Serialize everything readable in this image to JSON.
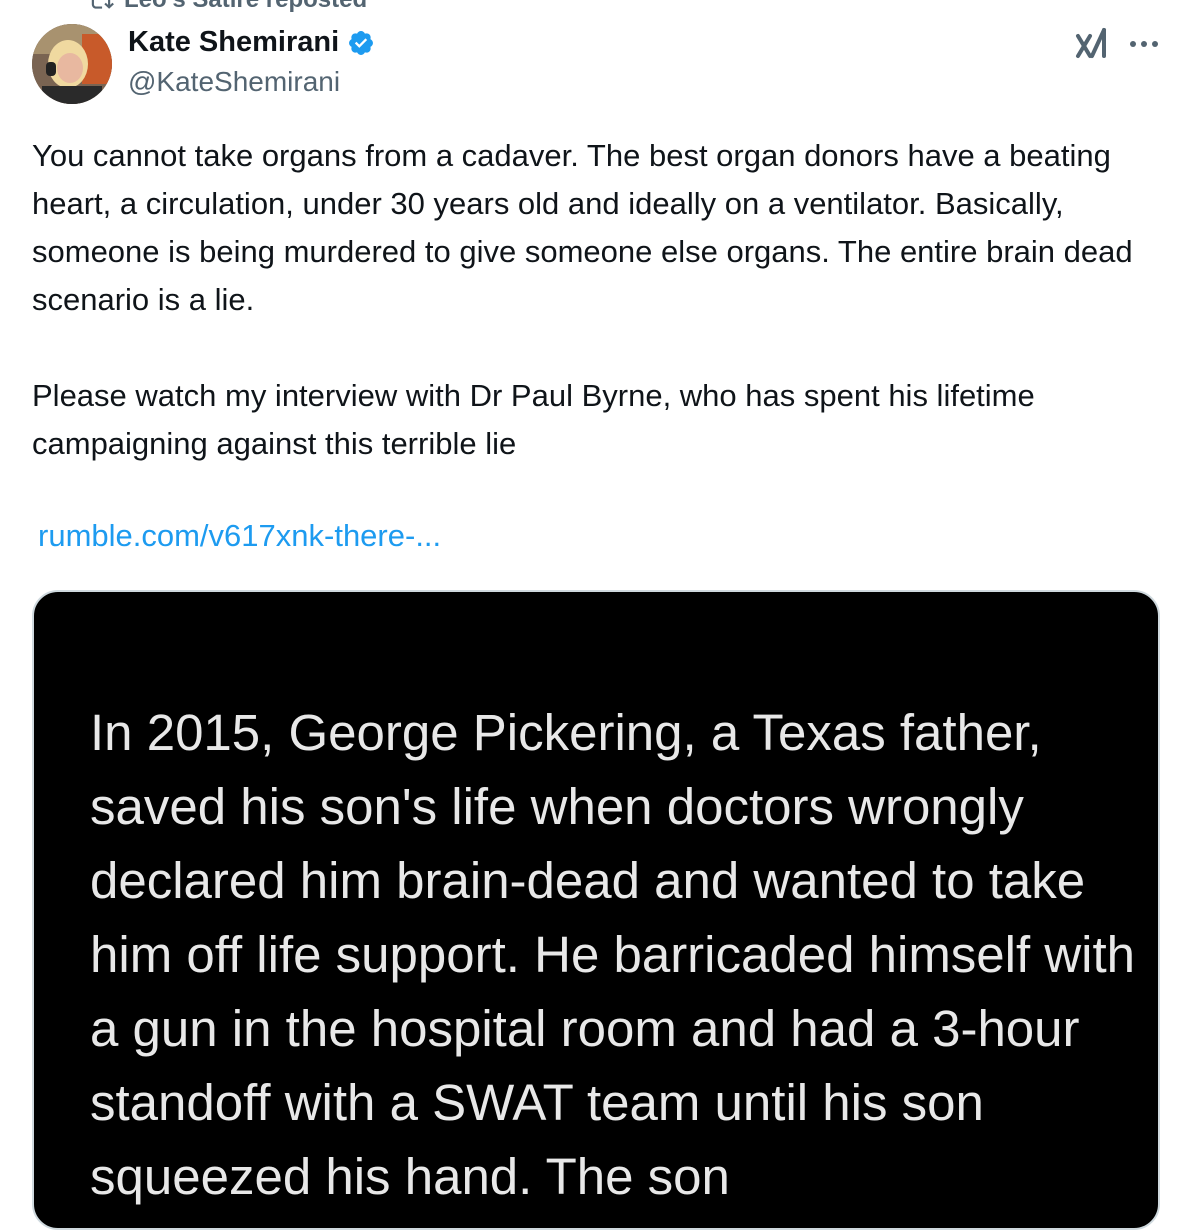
{
  "repost": {
    "label": "Leo's Satire reposted",
    "icon": "repost-icon"
  },
  "author": {
    "name": "Kate Shemirani",
    "handle": "@KateShemirani",
    "verified": true,
    "verified_color": "#1d9bf0"
  },
  "tweet": {
    "paragraphs": [
      "You cannot take organs from a cadaver. The best organ donors have a beating heart, a circulation, under 30 years old and ideally on a ventilator. Basically, someone is being murdered to give someone else organs. The entire brain dead scenario is a lie.",
      "Please watch my interview with Dr Paul Byrne, who has spent his lifetime campaigning against this terrible lie"
    ],
    "link_text": "rumble.com/v617xnk-there-..."
  },
  "media": {
    "text": "In 2015, George Pickering, a Texas father, saved his son's life when doctors wrongly declared him brain-dead and wanted to take him off life support. He barricaded himself with a gun in the hospital room and had a 3-hour standoff with a SWAT team until his son squeezed his hand. The son"
  },
  "colors": {
    "text": "#0f1419",
    "secondary": "#536471",
    "link": "#1d9bf0",
    "media_bg": "#000000"
  }
}
